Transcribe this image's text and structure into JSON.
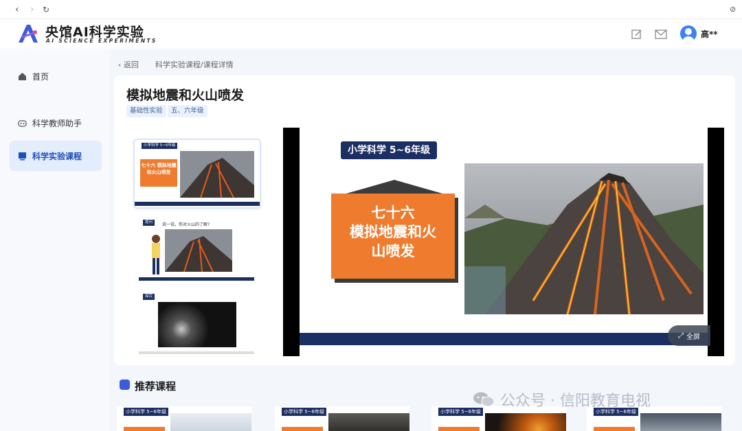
{
  "app": {
    "title": "央馆AI科学实验",
    "subtitle": "AI SCIENCE EXPERIMENTS",
    "user_name": "高**",
    "brand_color": "#3b5bdb"
  },
  "sidebar": {
    "items": [
      {
        "label": "首页",
        "icon": "home-icon",
        "active": false
      },
      {
        "label": "科学教师助手",
        "icon": "robot-icon",
        "active": false
      },
      {
        "label": "科学实验课程",
        "icon": "course-icon",
        "active": true
      }
    ]
  },
  "breadcrumb": {
    "back": "返回",
    "path": "科学实验课程/课程详情"
  },
  "course": {
    "title": "模拟地震和火山喷发",
    "tags": [
      "基础性实验",
      "五、六年级"
    ]
  },
  "thumbnails": [
    {
      "badge": "小学科学 5~6年级",
      "title": "七十六 模拟地震和火山喷发",
      "selected": true
    },
    {
      "badge": "提问",
      "caption": "说一说，你对火山的了解?",
      "selected": false
    },
    {
      "badge": "探究",
      "selected": false
    }
  ],
  "slide": {
    "badge": "小学科学 5~6年级",
    "title_line1": "七十六",
    "title_line2": "模拟地震和火",
    "title_line3": "山喷发",
    "fullscreen_label": "全屏",
    "accent": "#ef7b2e",
    "navy": "#1c2f63"
  },
  "recommend": {
    "title": "推荐课程",
    "cards": [
      {
        "badge": "小学科学 5~6年级"
      },
      {
        "badge": "小学科学 5~6年级"
      },
      {
        "badge": "小学科学 5~6年级"
      },
      {
        "badge": "小学科学 5~6年级"
      }
    ]
  },
  "watermark": {
    "text": "公众号 · 信阳教育电视"
  }
}
